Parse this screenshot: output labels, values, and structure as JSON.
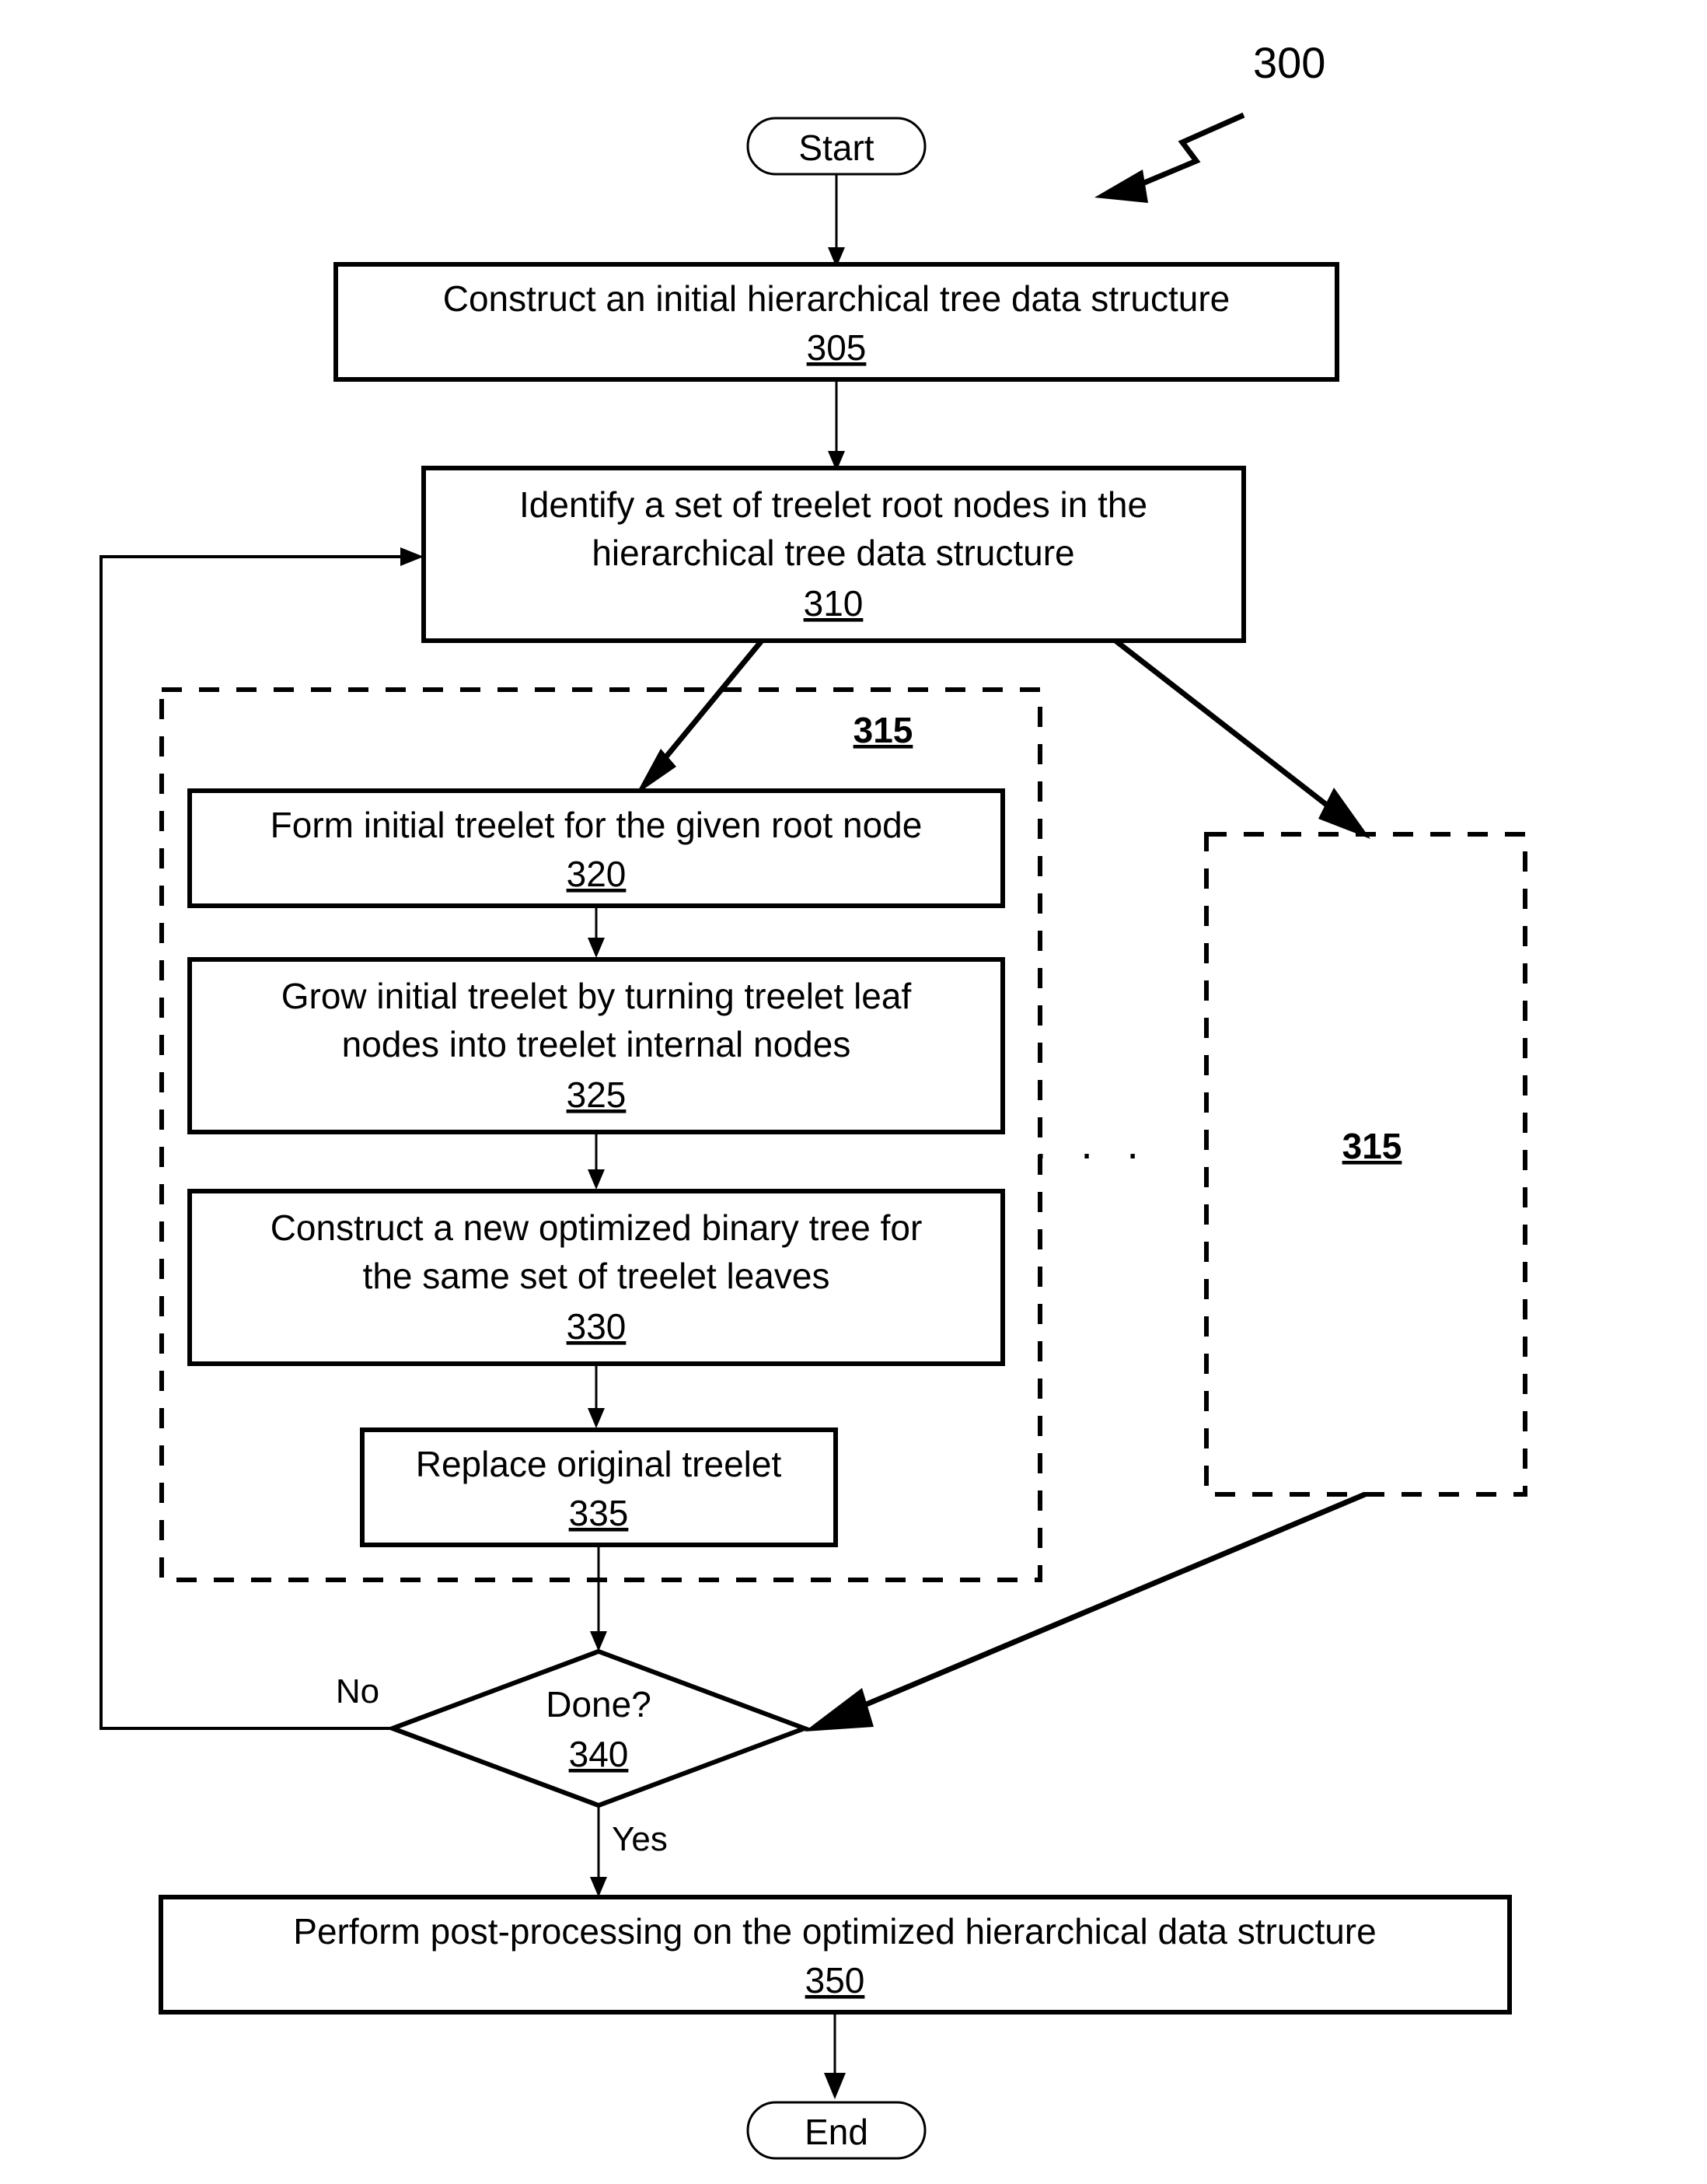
{
  "figure": {
    "number": "300",
    "leader_icon": "zigzag-leader-arrow-icon"
  },
  "terminators": {
    "start": "Start",
    "end": "End"
  },
  "steps": [
    {
      "id": "305",
      "lines": [
        "Construct an initial hierarchical tree data structure"
      ],
      "ref": "305"
    },
    {
      "id": "310",
      "lines": [
        "Identify a set of treelet root nodes in the",
        "hierarchical tree data structure"
      ],
      "ref": "310"
    },
    {
      "id": "320",
      "lines": [
        "Form initial treelet for the given root node"
      ],
      "ref": "320"
    },
    {
      "id": "325",
      "lines": [
        "Grow initial treelet by turning treelet leaf",
        "nodes into treelet internal nodes"
      ],
      "ref": "325"
    },
    {
      "id": "330",
      "lines": [
        "Construct a new optimized binary tree for",
        "the same set of treelet leaves"
      ],
      "ref": "330"
    },
    {
      "id": "335",
      "lines": [
        "Replace original treelet"
      ],
      "ref": "335"
    },
    {
      "id": "350",
      "lines": [
        "Perform post-processing on the optimized hierarchical data structure"
      ],
      "ref": "350"
    }
  ],
  "decision": {
    "id": "340",
    "label": "Done?",
    "ref": "340",
    "branch_no": "No",
    "branch_yes": "Yes"
  },
  "groups": {
    "left": {
      "ref": "315"
    },
    "right": {
      "ref": "315"
    },
    "ellipsis": ". . ."
  },
  "colors": {
    "stroke": "#000000",
    "fill": "#ffffff",
    "text": "#000000"
  }
}
